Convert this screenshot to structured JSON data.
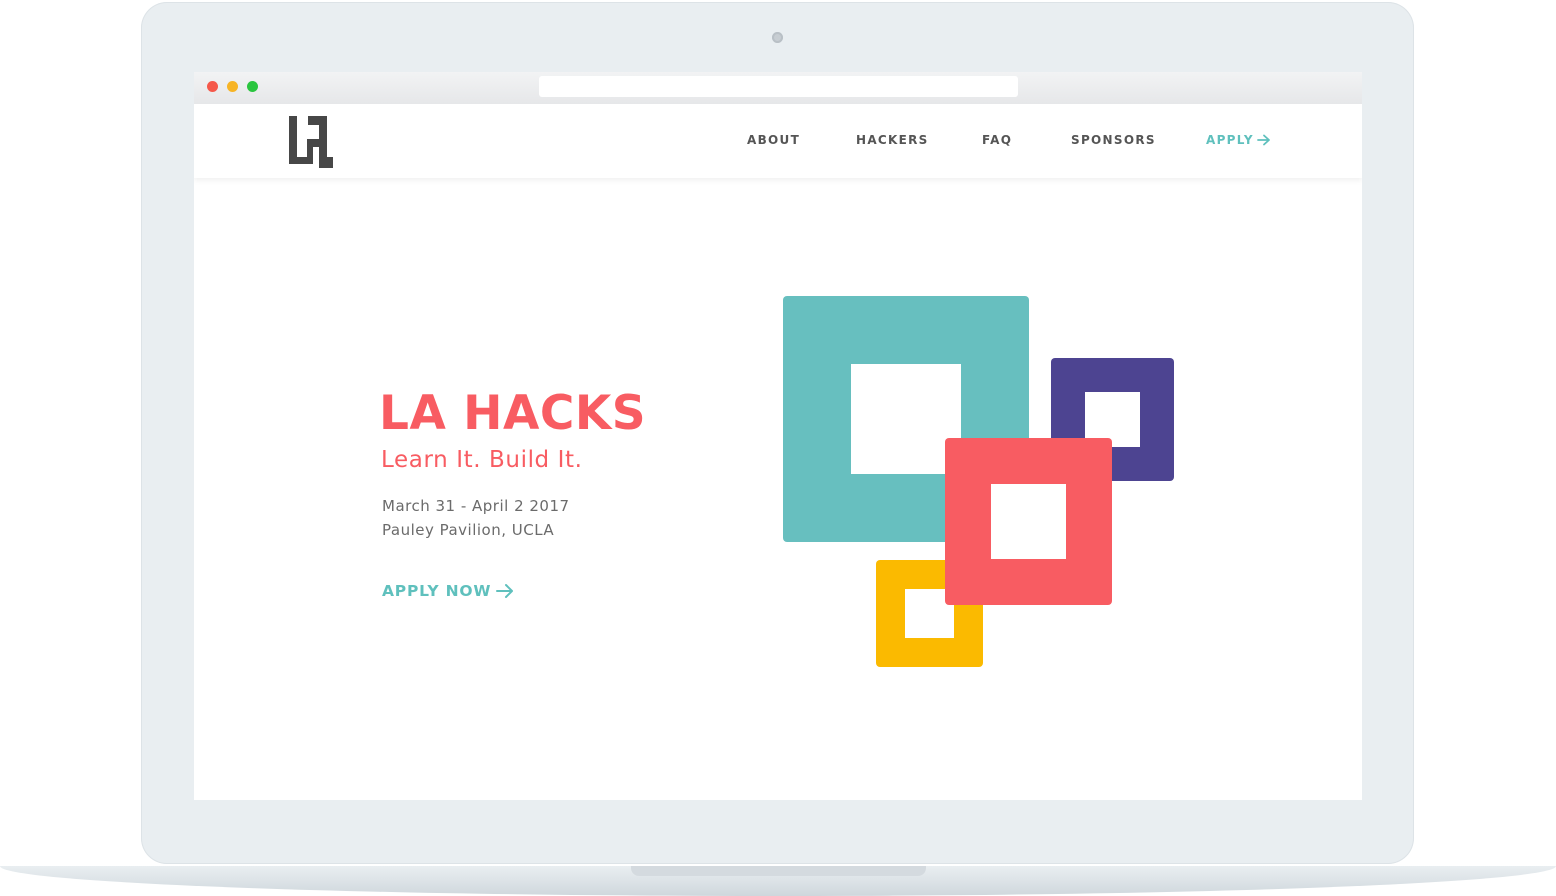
{
  "window": {
    "address_value": ""
  },
  "nav": {
    "logo_name": "LA Hacks logo",
    "items": [
      {
        "label": "ABOUT"
      },
      {
        "label": "HACKERS"
      },
      {
        "label": "FAQ"
      },
      {
        "label": "SPONSORS"
      }
    ],
    "apply_label": "APPLY",
    "apply_icon": "arrow-right-icon"
  },
  "hero": {
    "title": "LA HACKS",
    "tagline": "Learn It. Build It.",
    "date": "March 31 - April 2 2017",
    "location": "Pauley Pavilion, UCLA",
    "cta_label": "APPLY NOW",
    "cta_icon": "arrow-right-icon"
  },
  "colors": {
    "coral": "#f85c62",
    "teal": "#67bfbf",
    "purple": "#4d4491",
    "yellow": "#fbba00",
    "nav_text": "#555555",
    "accent": "#5fc0bd"
  }
}
